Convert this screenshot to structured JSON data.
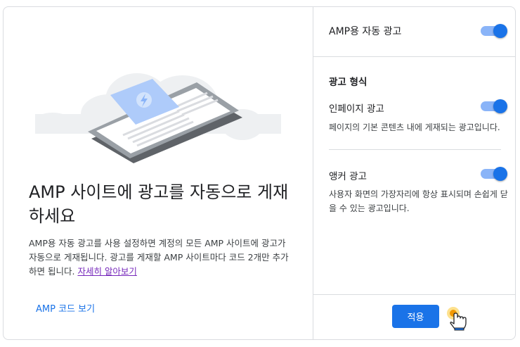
{
  "auto_ads": {
    "title": "AMP용 자동 광고",
    "enabled": true
  },
  "ad_formats": {
    "title": "광고 형식",
    "in_page": {
      "label": "인페이지 광고",
      "description": "페이지의 기본 콘텐츠 내에 게재되는 광고입니다.",
      "enabled": true
    },
    "anchor": {
      "label": "앵커 광고",
      "description": "사용자 화면의 가장자리에 항상 표시되며 손쉽게 닫을 수 있는 광고입니다.",
      "enabled": true
    }
  },
  "main": {
    "headline": "AMP 사이트에 광고를 자동으로 게재하세요",
    "description": "AMP용 자동 광고를 사용 설정하면 계정의 모든 AMP 사이트에 광고가 자동으로 게재됩니다. 광고를 게재할 AMP 사이트마다 코드 2개만 추가하면 됩니다.",
    "learn_more": "자세히 알아보기",
    "view_code": "AMP 코드 보기"
  },
  "footer": {
    "apply": "적용"
  },
  "colors": {
    "accent": "#1a73e8",
    "toggle_track": "#8ab4f8",
    "link_visited": "#7627bb"
  },
  "icons": {
    "illustration": "phone-ad-illustration",
    "cursor": "hand-pointer-icon"
  }
}
